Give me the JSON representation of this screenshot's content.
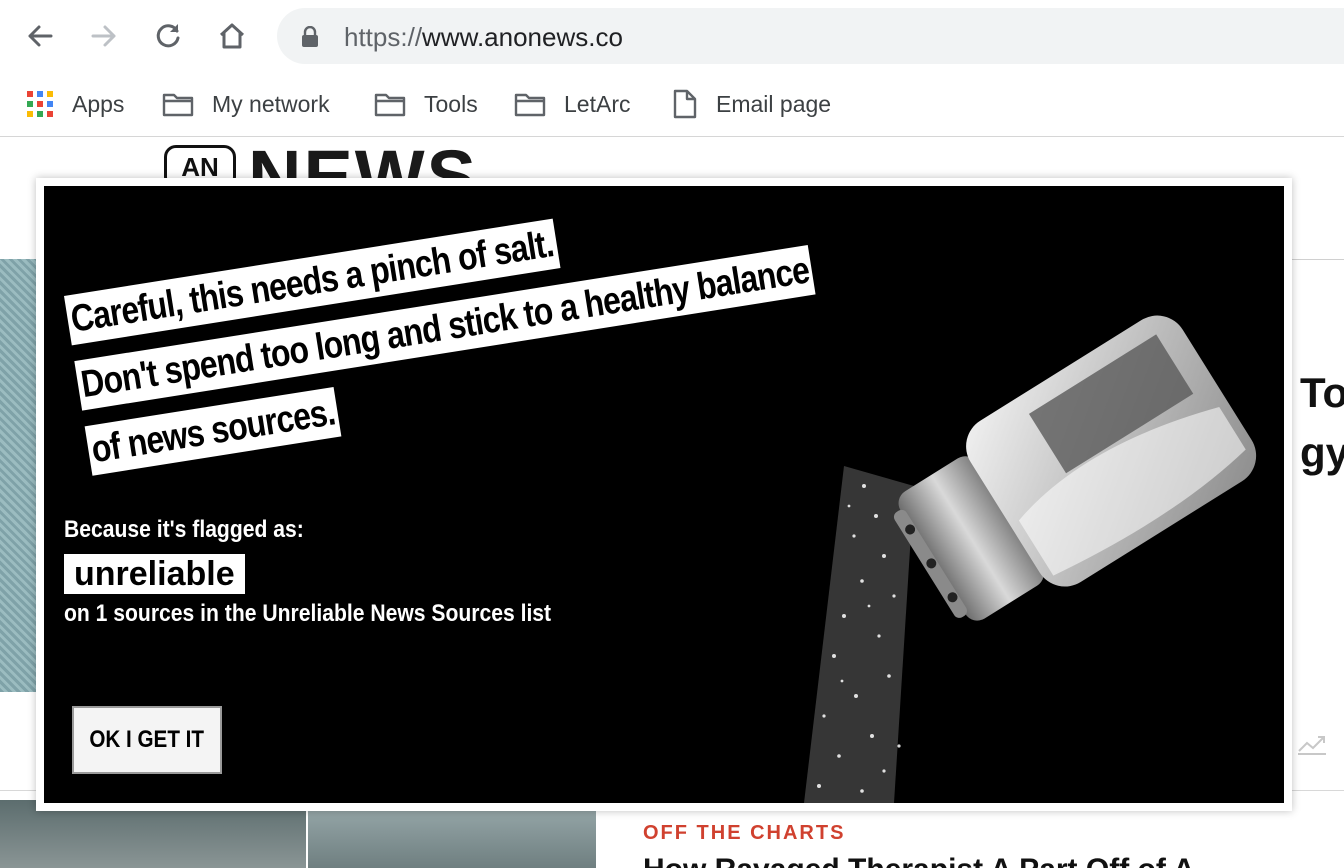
{
  "browser": {
    "url_scheme": "https://",
    "url_host": "www.anonews.co",
    "back_icon": "arrow-left-icon",
    "forward_icon": "arrow-right-icon",
    "reload_icon": "reload-icon",
    "home_icon": "home-icon",
    "lock_icon": "lock-icon"
  },
  "bookmarks": [
    {
      "label": "Apps",
      "icon": "apps-grid-icon"
    },
    {
      "label": "My network",
      "icon": "folder-icon"
    },
    {
      "label": "Tools",
      "icon": "folder-icon"
    },
    {
      "label": "LetArc",
      "icon": "folder-icon"
    },
    {
      "label": "Email page",
      "icon": "page-icon"
    }
  ],
  "site": {
    "logo_badge": "AN",
    "logo_word": "NEWS",
    "article_title_fragment": "To\ngy",
    "section_label": "OFF THE CHARTS",
    "headline_fragment": "How Ravaged Therapist A Part Off of A"
  },
  "modal": {
    "headline_lines": [
      "Careful, this needs a pinch of salt.",
      "Don't spend too long and stick to a healthy balance",
      "of news sources."
    ],
    "flag_intro": "Because it's flagged as:",
    "flag_value": "unreliable",
    "flag_source": "on 1 sources in the Unreliable News Sources list",
    "ok_button": "OK I GET IT",
    "illustration": "salt-shaker-image"
  },
  "colors": {
    "modal_bg": "#000000",
    "section_accent": "#d0412f",
    "omnibox_bg": "#f1f3f4"
  }
}
